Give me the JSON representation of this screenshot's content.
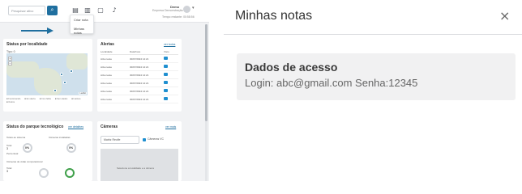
{
  "app": {
    "search_placeholder": "Pesquisar ativo",
    "user": {
      "name": "Demo",
      "company": "Empresa Demonstração",
      "remaining": "Tempo restante: 00:58:56"
    },
    "notes_menu": {
      "items": [
        "Criar nota",
        "Minhas notas"
      ]
    },
    "status_card": {
      "title": "Status por localidade",
      "map_label": "Tipo: 0",
      "map_attribution": "Leaflet",
      "legend": [
        "Funcionando",
        "Em alerta",
        "Com falha",
        "Sem dados",
        "Inativos",
        "Outros"
      ]
    },
    "alertas_card": {
      "title": "Alertas",
      "link": "ver todos",
      "columns": [
        "Localidade",
        "Data/hora",
        "Visto"
      ],
      "rows": [
        {
          "loc": "Ativo teste",
          "date": "30/07/2024 14:21"
        },
        {
          "loc": "Ativo teste",
          "date": "30/07/2024 14:21"
        },
        {
          "loc": "Ativo teste",
          "date": "30/07/2024 14:21"
        },
        {
          "loc": "Ativo teste",
          "date": "30/07/2024 14:21"
        },
        {
          "loc": "Ativo teste",
          "date": "30/07/2024 14:21"
        },
        {
          "loc": "Ativo teste",
          "date": "30/07/2024 14:21"
        }
      ]
    },
    "parque_card": {
      "title": "Status do parque tecnológico",
      "link": "ver detalhes",
      "sections": [
        "Totais ao sistema",
        "Câmeras instaladas",
        "Câmeras de visão computacional"
      ],
      "totals": {
        "total_label": "Total",
        "total": "3",
        "perc_label": "Percentual",
        "perc": "0%",
        "perc2": "0%"
      }
    },
    "cameras_card": {
      "title": "Câmeras",
      "link": "ver mais",
      "select_value": "Matriz Recife",
      "checkbox_label": "Câmeras VC",
      "preview_text": "Selecione a localidade e a câmera"
    }
  },
  "modal": {
    "title": "Minhas notas",
    "close": "×",
    "note": {
      "title": "Dados de acesso",
      "body": "Login: abc@gmail.com Senha:12345"
    }
  }
}
